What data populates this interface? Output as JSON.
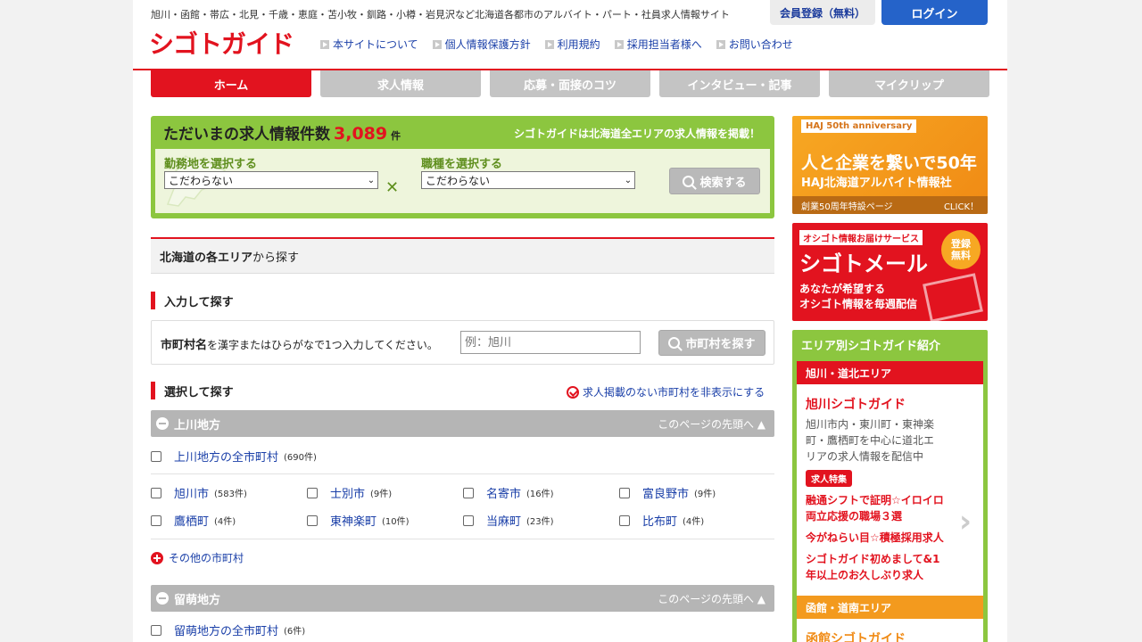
{
  "header": {
    "tagline": "旭川・函館・帯広・北見・千歳・恵庭・苫小牧・釧路・小樽・岩見沢など北海道各都市のアルバイト・パート・社員求人情報サイト",
    "logo": "シゴトガイド",
    "links": [
      "本サイトについて",
      "個人情報保護方針",
      "利用規約",
      "採用担当者様へ",
      "お問い合わせ"
    ],
    "register_label": "会員登録（無料）",
    "login_label": "ログイン"
  },
  "nav": {
    "tabs": [
      "ホーム",
      "求人情報",
      "応募・面接のコツ",
      "インタビュー・記事",
      "マイクリップ"
    ]
  },
  "search": {
    "title": "ただいまの求人情報件数",
    "count": "3,089",
    "unit": "件",
    "note": "シゴトガイドは北海道全エリアの求人情報を掲載！",
    "location_label": "勤務地を選択する",
    "location_value": "こだわらない",
    "job_label": "職種を選択する",
    "job_value": "こだわらない",
    "button_label": "検索する"
  },
  "area": {
    "heading_bold": "北海道の各エリア",
    "heading_rest": "から探す",
    "input_section": "入力して探す",
    "input_label_bold": "市町村名",
    "input_label_rest": "を漢字またはひらがなで1つ入力してください。",
    "input_placeholder": "例：旭川",
    "input_button": "市町村を探す",
    "select_section": "選択して探す",
    "hide_toggle": "求人掲載のない市町村を非表示にする",
    "page_top": "このページの先頭へ",
    "more_label": "その他の市町村",
    "regions": [
      {
        "name": "上川地方",
        "all_label": "上川地方の全市町村",
        "all_count": "(690件)",
        "towns": [
          {
            "name": "旭川市",
            "count": "(583件)"
          },
          {
            "name": "士別市",
            "count": "(9件)"
          },
          {
            "name": "名寄市",
            "count": "(16件)"
          },
          {
            "name": "富良野市",
            "count": "(9件)"
          },
          {
            "name": "鷹栖町",
            "count": "(4件)"
          },
          {
            "name": "東神楽町",
            "count": "(10件)"
          },
          {
            "name": "当麻町",
            "count": "(23件)"
          },
          {
            "name": "比布町",
            "count": "(4件)"
          }
        ]
      },
      {
        "name": "留萌地方",
        "all_label": "留萌地方の全市町村",
        "all_count": "(6件)"
      }
    ]
  },
  "sidebar": {
    "haj": {
      "badge": "HAJ 50th anniversary",
      "main": "人と企業を繋いで50年",
      "sub": "HAJ北海道アルバイト情報社",
      "foot_left": "創業50周年特設ページ",
      "foot_right": "CLICK！"
    },
    "mail": {
      "top": "オシゴト情報お届けサービス",
      "title": "シゴトメール",
      "circle_1": "登録",
      "circle_2": "無料",
      "desc_1": "あなたが希望する",
      "desc_2": "オシゴト情報を毎週配信"
    },
    "area_panel": {
      "title": "エリア別シゴトガイド紹介",
      "card1_head": "旭川・道北エリア",
      "card1_title": "旭川シゴトガイド",
      "card1_desc": "旭川市内・東川町・東神楽町・鷹栖町を中心に道北エリアの求人情報を配信中",
      "card1_badge": "求人特集",
      "card1_link1": "融通シフトで証明☆イロイロ両立応援の職場３選",
      "card1_link2": "今がねらい目☆積極採用求人",
      "card1_link3": "シゴトガイド初めまして&1年以上のお久しぶり求人",
      "card2_head": "函館・道南エリア",
      "card2_title": "函館シゴトガイド"
    }
  }
}
